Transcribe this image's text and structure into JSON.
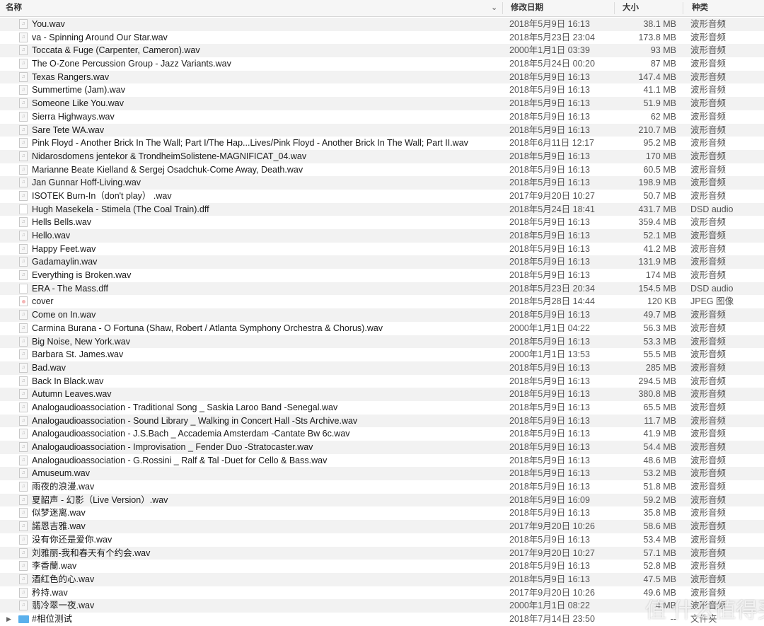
{
  "header": {
    "name": "名称",
    "date": "修改日期",
    "size": "大小",
    "kind": "种类",
    "sort_icon": "chevron-down-icon"
  },
  "watermark": "值 什么值得买",
  "rows": [
    {
      "name": "You.wav",
      "date": "2018年5月9日 16:13",
      "size": "38.1 MB",
      "kind": "波形音频",
      "icon": "audio"
    },
    {
      "name": "va - Spinning Around Our Star.wav",
      "date": "2018年5月23日 23:04",
      "size": "173.8 MB",
      "kind": "波形音频",
      "icon": "audio"
    },
    {
      "name": "Toccata & Fuge (Carpenter, Cameron).wav",
      "date": "2000年1月1日 03:39",
      "size": "93 MB",
      "kind": "波形音频",
      "icon": "audio"
    },
    {
      "name": "The O-Zone Percussion Group - Jazz Variants.wav",
      "date": "2018年5月24日 00:20",
      "size": "87 MB",
      "kind": "波形音频",
      "icon": "audio"
    },
    {
      "name": "Texas Rangers.wav",
      "date": "2018年5月9日 16:13",
      "size": "147.4 MB",
      "kind": "波形音频",
      "icon": "audio"
    },
    {
      "name": "Summertime (Jam).wav",
      "date": "2018年5月9日 16:13",
      "size": "41.1 MB",
      "kind": "波形音频",
      "icon": "audio"
    },
    {
      "name": "Someone Like You.wav",
      "date": "2018年5月9日 16:13",
      "size": "51.9 MB",
      "kind": "波形音频",
      "icon": "audio"
    },
    {
      "name": "Sierra Highways.wav",
      "date": "2018年5月9日 16:13",
      "size": "62 MB",
      "kind": "波形音频",
      "icon": "audio"
    },
    {
      "name": "Sare Tete WA.wav",
      "date": "2018年5月9日 16:13",
      "size": "210.7 MB",
      "kind": "波形音频",
      "icon": "audio"
    },
    {
      "name": "Pink Floyd - Another Brick In The Wall; Part I/The Hap...Lives/Pink Floyd - Another Brick In The Wall; Part II.wav",
      "date": "2018年6月11日 12:17",
      "size": "95.2 MB",
      "kind": "波形音频",
      "icon": "audio"
    },
    {
      "name": "Nidarosdomens jentekor & TrondheimSolistene-MAGNIFICAT_04.wav",
      "date": "2018年5月9日 16:13",
      "size": "170 MB",
      "kind": "波形音频",
      "icon": "audio"
    },
    {
      "name": "Marianne Beate Kielland & Sergej Osadchuk-Come Away, Death.wav",
      "date": "2018年5月9日 16:13",
      "size": "60.5 MB",
      "kind": "波形音频",
      "icon": "audio"
    },
    {
      "name": "Jan Gunnar Hoff-Living.wav",
      "date": "2018年5月9日 16:13",
      "size": "198.9 MB",
      "kind": "波形音频",
      "icon": "audio"
    },
    {
      "name": "ISOTEK Burn-In（don't play） .wav",
      "date": "2017年9月20日 10:27",
      "size": "50.7 MB",
      "kind": "波形音频",
      "icon": "audio"
    },
    {
      "name": "Hugh Masekela - Stimela (The Coal Train).dff",
      "date": "2018年5月24日 18:41",
      "size": "431.7 MB",
      "kind": "DSD audio",
      "icon": "doc"
    },
    {
      "name": "Hells Bells.wav",
      "date": "2018年5月9日 16:13",
      "size": "359.4 MB",
      "kind": "波形音频",
      "icon": "audio"
    },
    {
      "name": "Hello.wav",
      "date": "2018年5月9日 16:13",
      "size": "52.1 MB",
      "kind": "波形音频",
      "icon": "audio"
    },
    {
      "name": "Happy Feet.wav",
      "date": "2018年5月9日 16:13",
      "size": "41.2 MB",
      "kind": "波形音频",
      "icon": "audio"
    },
    {
      "name": "Gadamaylin.wav",
      "date": "2018年5月9日 16:13",
      "size": "131.9 MB",
      "kind": "波形音频",
      "icon": "audio"
    },
    {
      "name": "Everything is Broken.wav",
      "date": "2018年5月9日 16:13",
      "size": "174 MB",
      "kind": "波形音频",
      "icon": "audio"
    },
    {
      "name": "ERA - The Mass.dff",
      "date": "2018年5月23日 20:34",
      "size": "154.5 MB",
      "kind": "DSD audio",
      "icon": "doc"
    },
    {
      "name": "cover",
      "date": "2018年5月28日 14:44",
      "size": "120 KB",
      "kind": "JPEG 图像",
      "icon": "img"
    },
    {
      "name": "Come on In.wav",
      "date": "2018年5月9日 16:13",
      "size": "49.7 MB",
      "kind": "波形音频",
      "icon": "audio"
    },
    {
      "name": "Carmina Burana - O Fortuna (Shaw, Robert / Atlanta Symphony Orchestra & Chorus).wav",
      "date": "2000年1月1日 04:22",
      "size": "56.3 MB",
      "kind": "波形音频",
      "icon": "audio"
    },
    {
      "name": "Big Noise, New York.wav",
      "date": "2018年5月9日 16:13",
      "size": "53.3 MB",
      "kind": "波形音频",
      "icon": "audio"
    },
    {
      "name": "Barbara St. James.wav",
      "date": "2000年1月1日 13:53",
      "size": "55.5 MB",
      "kind": "波形音频",
      "icon": "audio"
    },
    {
      "name": "Bad.wav",
      "date": "2018年5月9日 16:13",
      "size": "285 MB",
      "kind": "波形音频",
      "icon": "audio"
    },
    {
      "name": "Back In Black.wav",
      "date": "2018年5月9日 16:13",
      "size": "294.5 MB",
      "kind": "波形音频",
      "icon": "audio"
    },
    {
      "name": "Autumn Leaves.wav",
      "date": "2018年5月9日 16:13",
      "size": "380.8 MB",
      "kind": "波形音频",
      "icon": "audio"
    },
    {
      "name": "Analogaudioassociation - Traditional Song _ Saskia Laroo Band -Senegal.wav",
      "date": "2018年5月9日 16:13",
      "size": "65.5 MB",
      "kind": "波形音频",
      "icon": "audio"
    },
    {
      "name": "Analogaudioassociation - Sound Library _ Walking in Concert Hall -Sts Archive.wav",
      "date": "2018年5月9日 16:13",
      "size": "11.7 MB",
      "kind": "波形音频",
      "icon": "audio"
    },
    {
      "name": "Analogaudioassociation - J.S.Bach _ Accademia Amsterdam -Cantate Bw 6c.wav",
      "date": "2018年5月9日 16:13",
      "size": "41.9 MB",
      "kind": "波形音频",
      "icon": "audio"
    },
    {
      "name": "Analogaudioassociation - Improvisation _ Fender Duo -Stratocaster.wav",
      "date": "2018年5月9日 16:13",
      "size": "54.4 MB",
      "kind": "波形音频",
      "icon": "audio"
    },
    {
      "name": "Analogaudioassociation - G.Rossini _ Ralf & Tal -Duet for Cello & Bass.wav",
      "date": "2018年5月9日 16:13",
      "size": "48.6 MB",
      "kind": "波形音频",
      "icon": "audio"
    },
    {
      "name": "Amuseum.wav",
      "date": "2018年5月9日 16:13",
      "size": "53.2 MB",
      "kind": "波形音频",
      "icon": "audio"
    },
    {
      "name": "雨夜的浪漫.wav",
      "date": "2018年5月9日 16:13",
      "size": "51.8 MB",
      "kind": "波形音频",
      "icon": "audio"
    },
    {
      "name": "夏韶声 - 幻影（Live Version）.wav",
      "date": "2018年5月9日 16:09",
      "size": "59.2 MB",
      "kind": "波形音频",
      "icon": "audio"
    },
    {
      "name": "似梦迷离.wav",
      "date": "2018年5月9日 16:13",
      "size": "35.8 MB",
      "kind": "波形音频",
      "icon": "audio"
    },
    {
      "name": "諾恩吉雅.wav",
      "date": "2017年9月20日 10:26",
      "size": "58.6 MB",
      "kind": "波形音频",
      "icon": "audio"
    },
    {
      "name": "没有你还是爱你.wav",
      "date": "2018年5月9日 16:13",
      "size": "53.4 MB",
      "kind": "波形音频",
      "icon": "audio"
    },
    {
      "name": "刘雅丽-我和春天有个约会.wav",
      "date": "2017年9月20日 10:27",
      "size": "57.1 MB",
      "kind": "波形音频",
      "icon": "audio"
    },
    {
      "name": "李香蘭.wav",
      "date": "2018年5月9日 16:13",
      "size": "52.8 MB",
      "kind": "波形音频",
      "icon": "audio"
    },
    {
      "name": "酒红色的心.wav",
      "date": "2018年5月9日 16:13",
      "size": "47.5 MB",
      "kind": "波形音频",
      "icon": "audio"
    },
    {
      "name": "矜持.wav",
      "date": "2017年9月20日 10:26",
      "size": "49.6 MB",
      "kind": "波形音频",
      "icon": "audio"
    },
    {
      "name": "翡冷翠一夜.wav",
      "date": "2000年1月1日 08:22",
      "size": "4 MB",
      "kind": "波形音频",
      "icon": "audio"
    },
    {
      "name": "#相位测试",
      "date": "2018年7月14日 23:50",
      "size": "--",
      "kind": "文件夹",
      "icon": "folder"
    }
  ]
}
